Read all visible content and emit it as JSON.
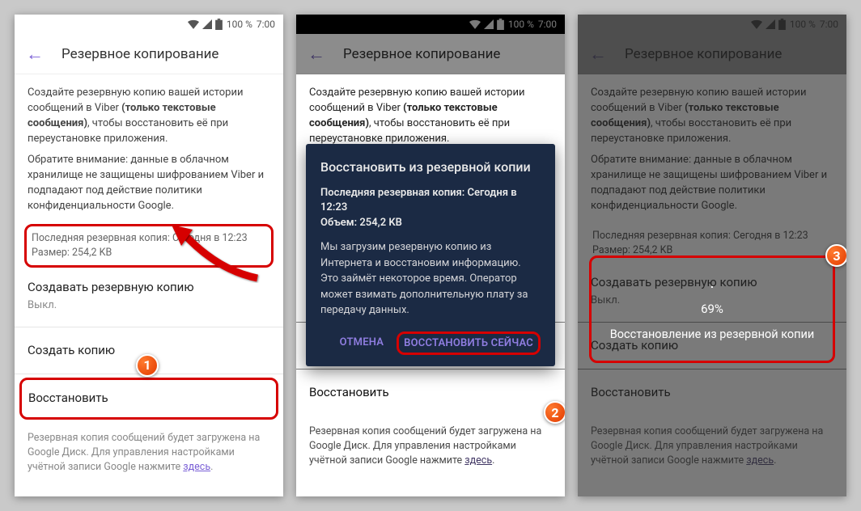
{
  "status": {
    "battery": "100 %",
    "time": "7:00"
  },
  "app": {
    "title": "Резервное копирование"
  },
  "desc": {
    "line1_pre": "Создайте резервную копию вашей истории сообщений в Viber ",
    "line1_bold": "(только текстовые сообщения)",
    "line1_post": ", чтобы восстановить её при переустановке приложения.",
    "line2": "Обратите внимание: данные в облачном хранилище не защищены шифрованием Viber и подпадают под действие политики конфиденциальности Google."
  },
  "info": {
    "last_backup": "Последняя резервная копия: Сегодня в 12:23",
    "size": "Размер: 254,2 KB"
  },
  "backup_setting": {
    "label": "Создавать резервную копию",
    "value": "Выкл."
  },
  "rows": {
    "create": "Создать копию",
    "restore": "Восстановить"
  },
  "footer": {
    "text": "Резервная копия сообщений будет загружена на Google Диск. Для управления настройками учётной записи Google нажмите ",
    "link": "здесь"
  },
  "dialog": {
    "title": "Восстановить из резервной копии",
    "sub_line1": "Последняя резервная копия: Сегодня в 12:23",
    "sub_line2": "Объем: 254,2 KB",
    "body": "Мы загрузим резервную копию из Интернета и восстановим информацию.\nЭто займёт некоторое время. Оператор может взимать дополнительную плату за передачу данных.",
    "cancel": "ОТМЕНА",
    "confirm": "ВОССТАНОВИТЬ СЕЙЧАС"
  },
  "progress": {
    "percent": "69%",
    "label": "Восстановление из резервной копии"
  },
  "badges": {
    "b1": "1",
    "b2": "2",
    "b3": "3"
  }
}
